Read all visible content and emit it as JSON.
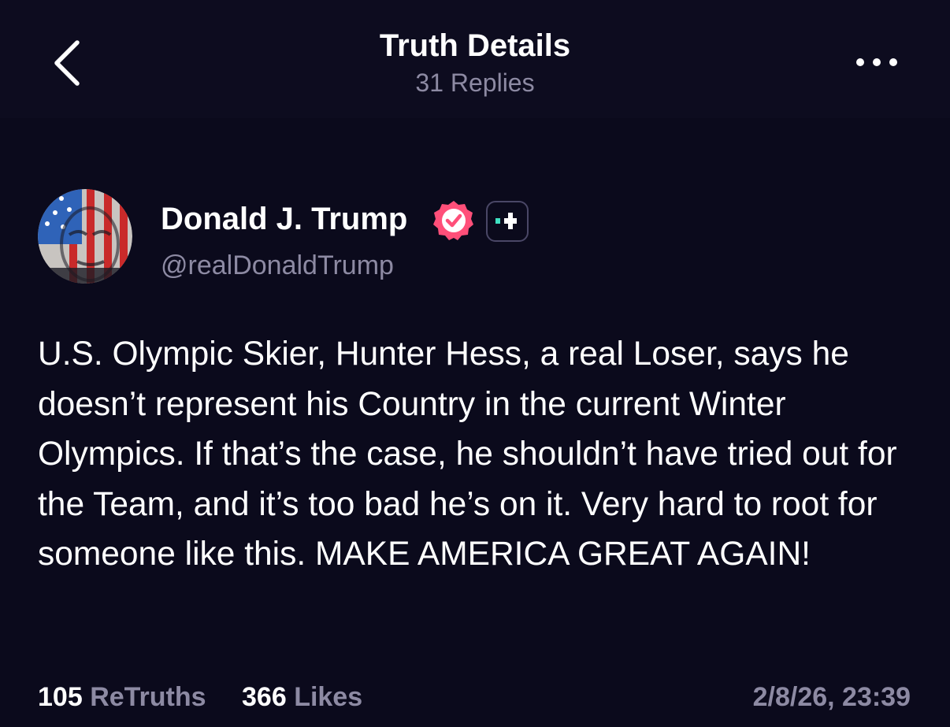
{
  "header": {
    "title": "Truth Details",
    "subtitle": "31 Replies",
    "back_icon": "chevron-left-icon",
    "more_icon": "ellipsis-icon"
  },
  "author": {
    "name": "Donald J. Trump",
    "handle": "@realDonaldTrump",
    "verified_color": "#ff4f79",
    "badge_icon": "plus-badge-icon",
    "badge_accent": "#3fe0c1"
  },
  "post": {
    "text": "U.S. Olympic Skier, Hunter Hess, a real Loser, says he doesn’t represent his Country in the current Winter Olympics. If that’s the case, he shouldn’t have tried out for the Team, and it’s too bad he’s on it. Very hard to root for someone like this. MAKE AMERICA GREAT AGAIN!"
  },
  "stats": {
    "retruths_count": "105",
    "retruths_label": "ReTruths",
    "likes_count": "366",
    "likes_label": "Likes",
    "timestamp": "2/8/26, 23:39"
  },
  "colors": {
    "background": "#0b0a1c",
    "text_primary": "#ffffff",
    "text_secondary": "#8d8aa3"
  }
}
